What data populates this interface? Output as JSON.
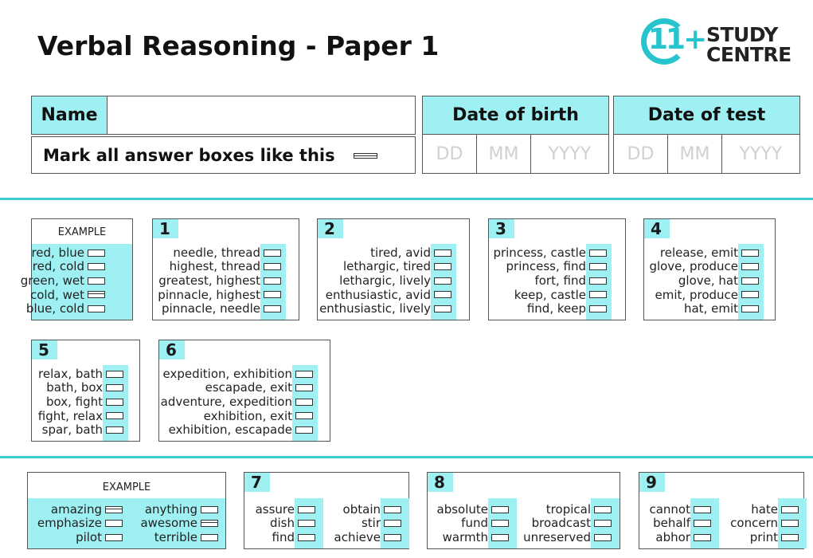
{
  "header": {
    "title": "Verbal Reasoning - Paper 1",
    "logo": {
      "number": "11+",
      "line1": "STUDY",
      "line2": "CENTRE",
      "color": "#27c4cf"
    }
  },
  "form": {
    "name_label": "Name",
    "name_value": "",
    "mark_instruction": "Mark all answer boxes like this",
    "date_of_birth": {
      "label": "Date of birth",
      "placeholders": [
        "DD",
        "MM",
        "YYYY"
      ]
    },
    "date_of_test": {
      "label": "Date of test",
      "placeholders": [
        "DD",
        "MM",
        "YYYY"
      ]
    }
  },
  "colors": {
    "accent": "#9ef0f2",
    "rule": "#3ccbd0"
  },
  "section1": {
    "example": {
      "label": "EXAMPLE",
      "options": [
        "red, blue",
        "red, cold",
        "green, wet",
        "cold, wet",
        "blue, cold"
      ],
      "marked": [
        3
      ]
    },
    "questions": [
      {
        "number": "1",
        "options": [
          "needle, thread",
          "highest, thread",
          "greatest, highest",
          "pinnacle, highest",
          "pinnacle, needle"
        ]
      },
      {
        "number": "2",
        "options": [
          "tired, avid",
          "lethargic, tired",
          "lethargic, lively",
          "enthusiastic, avid",
          "enthusiastic, lively"
        ]
      },
      {
        "number": "3",
        "options": [
          "princess, castle",
          "princess, find",
          "fort, find",
          "keep, castle",
          "find, keep"
        ]
      },
      {
        "number": "4",
        "options": [
          "release, emit",
          "glove, produce",
          "glove, hat",
          "emit, produce",
          "hat, emit"
        ]
      },
      {
        "number": "5",
        "options": [
          "relax, bath",
          "bath, box",
          "box, fight",
          "fight, relax",
          "spar, bath"
        ]
      },
      {
        "number": "6",
        "options": [
          "expedition, exhibition",
          "escapade, exit",
          "adventure, expedition",
          "exhibition, exit",
          "exhibition, escapade"
        ]
      }
    ]
  },
  "section2": {
    "example": {
      "label": "EXAMPLE",
      "left": [
        "amazing",
        "emphasize",
        "pilot"
      ],
      "right": [
        "anything",
        "awesome",
        "terrible"
      ],
      "marked_left": [
        0
      ],
      "marked_right": [
        1
      ]
    },
    "questions": [
      {
        "number": "7",
        "left": [
          "assure",
          "dish",
          "find"
        ],
        "right": [
          "obtain",
          "stir",
          "achieve"
        ]
      },
      {
        "number": "8",
        "left": [
          "absolute",
          "fund",
          "warmth"
        ],
        "right": [
          "tropical",
          "broadcast",
          "unreserved"
        ]
      },
      {
        "number": "9",
        "left": [
          "cannot",
          "behalf",
          "abhor"
        ],
        "right": [
          "hate",
          "concern",
          "print"
        ]
      }
    ]
  }
}
